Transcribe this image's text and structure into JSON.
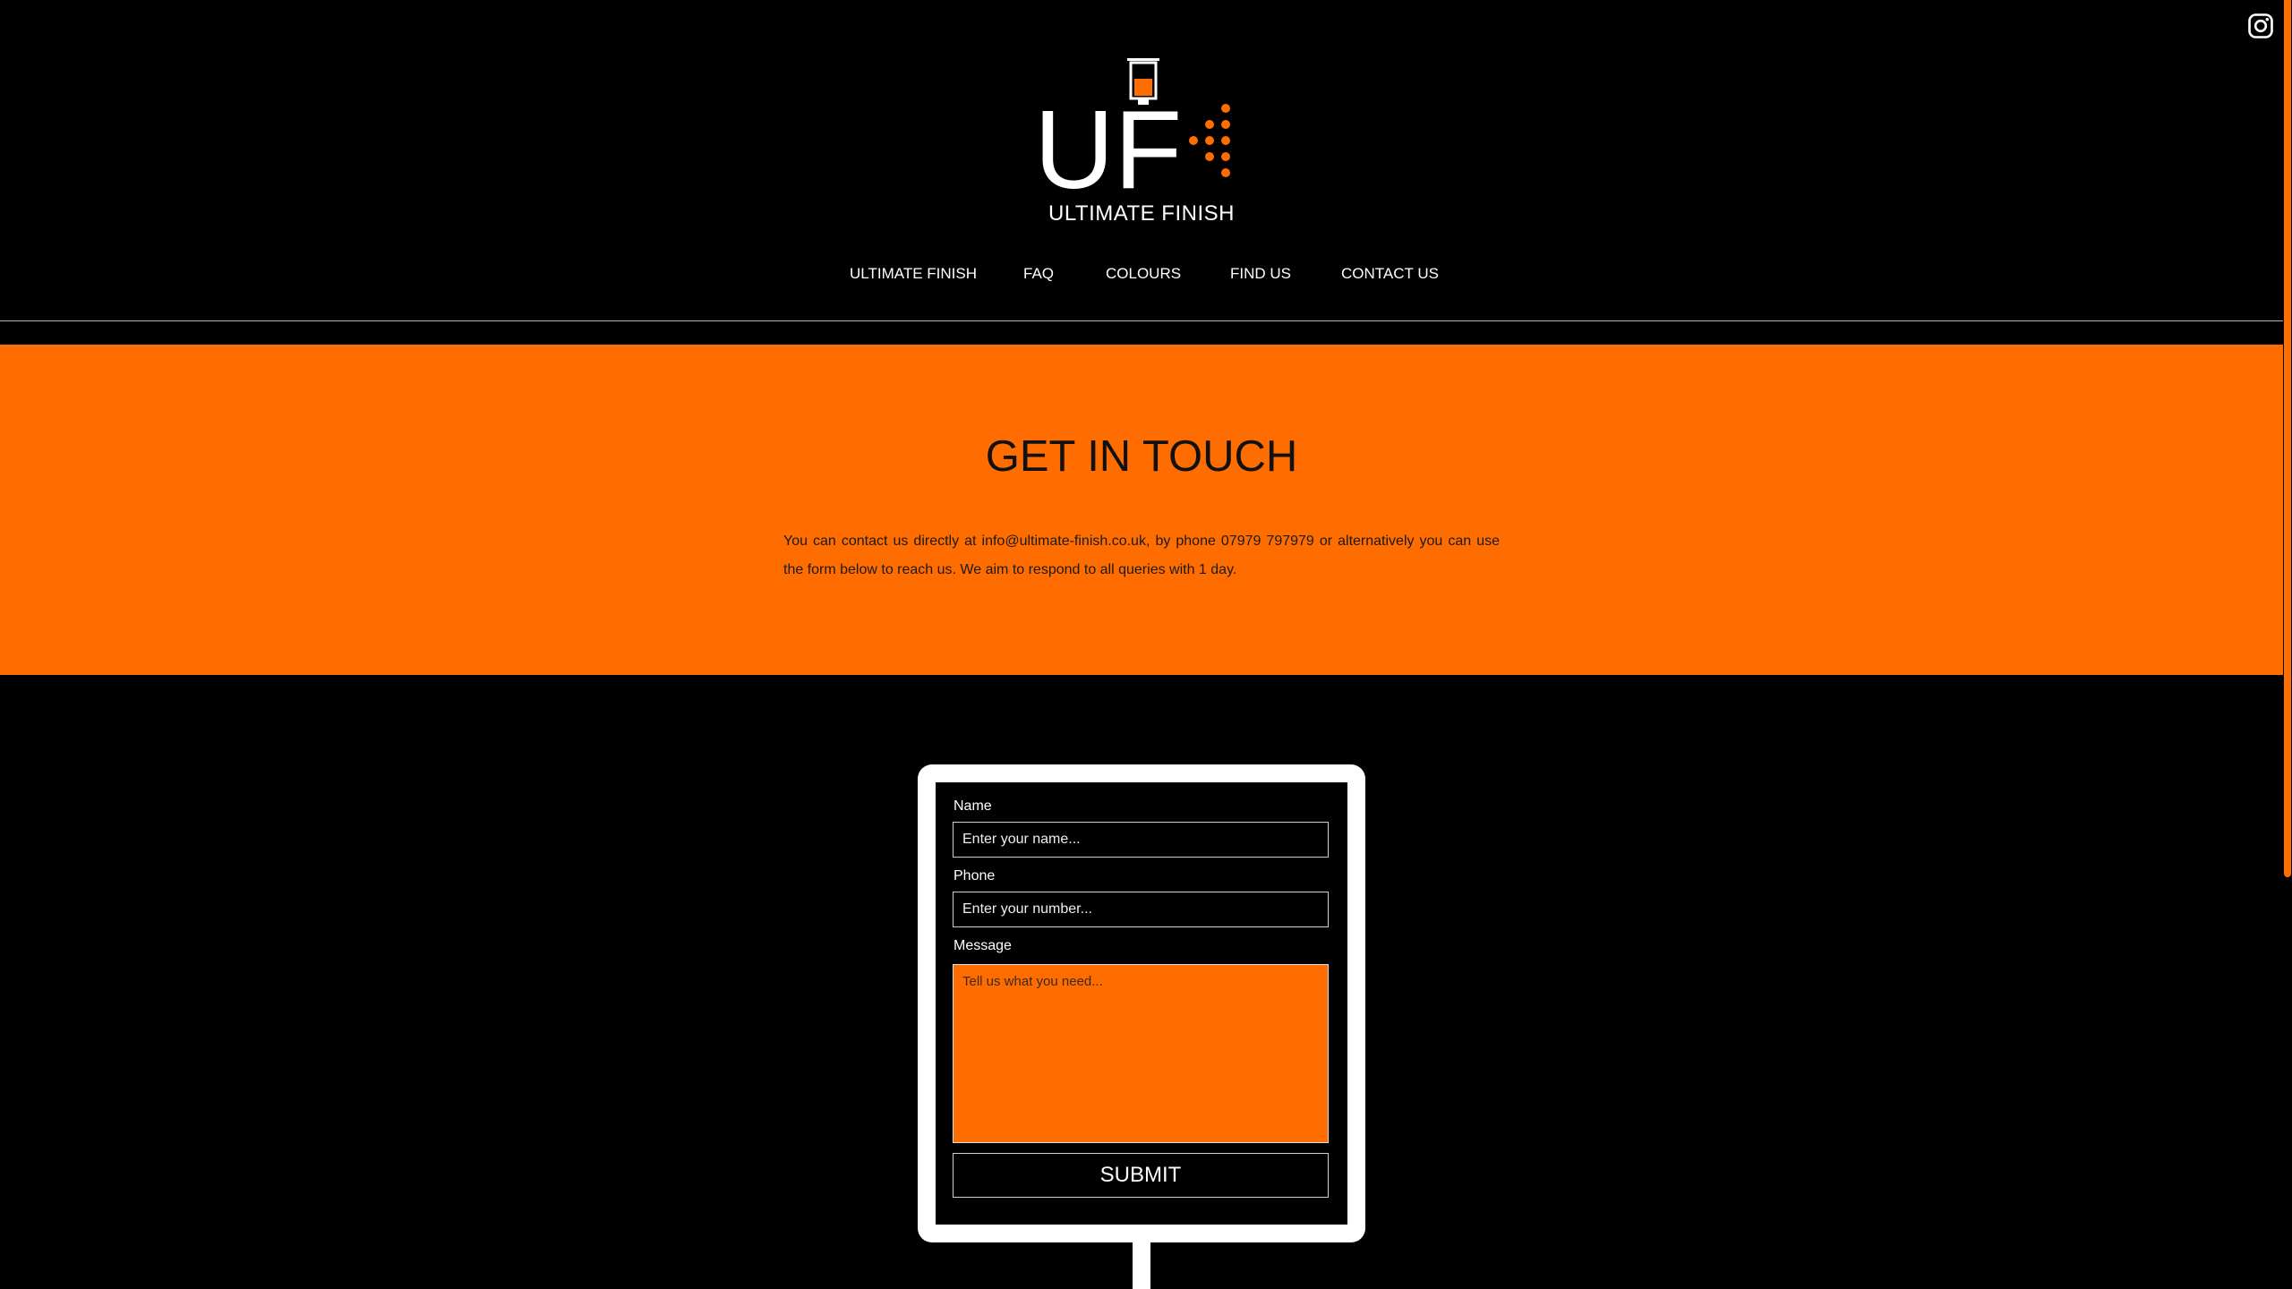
{
  "brand": {
    "logo_letters": "UF",
    "name": "ULTIMATE FINISH",
    "accent_color": "#ff6d00"
  },
  "social": {
    "icon": "instagram-icon"
  },
  "nav": {
    "items": [
      {
        "label": "ULTIMATE FINISH"
      },
      {
        "label": "FAQ"
      },
      {
        "label": "COLOURS"
      },
      {
        "label": "FIND US"
      },
      {
        "label": "CONTACT US"
      }
    ]
  },
  "contact": {
    "title": "GET IN TOUCH",
    "intro": "You can contact us directly at info@ultimate-finish.co.uk, by phone 07979 797979 or alternatively you can use the form below to reach us. We aim to respond to all queries with 1 day."
  },
  "form": {
    "name_label": "Name",
    "name_placeholder": "Enter your name...",
    "phone_label": "Phone",
    "phone_placeholder": "Enter your number...",
    "message_label": "Message",
    "message_placeholder": "Tell us what you need...",
    "submit_label": "SUBMIT"
  }
}
